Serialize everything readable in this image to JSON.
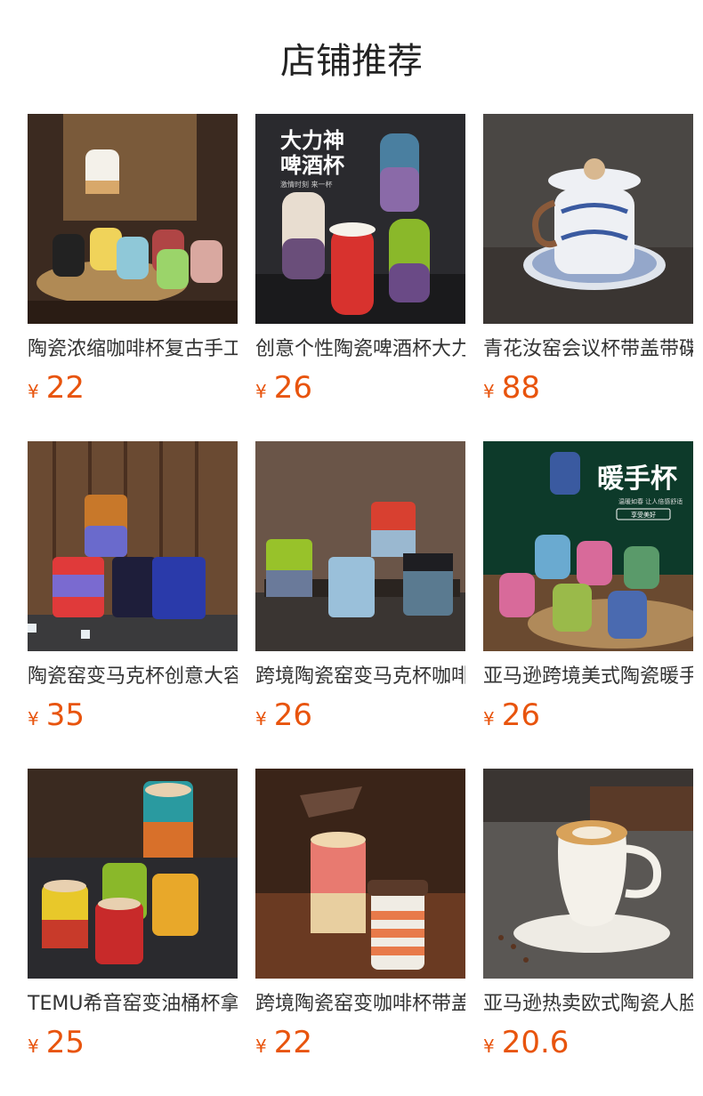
{
  "header": {
    "title": "店铺推荐"
  },
  "currency_symbol": "¥",
  "colors": {
    "price": "#e8540d"
  },
  "products": [
    {
      "name": "陶瓷浓缩咖啡杯复古手工窑变杯",
      "price": "22"
    },
    {
      "name": "创意个性陶瓷啤酒杯大力神杯",
      "price": "26",
      "image_text": [
        "大力神",
        "啤酒杯",
        "激情时刻 来一杯"
      ]
    },
    {
      "name": "青花汝窑会议杯带盖带碟套装",
      "price": "88"
    },
    {
      "name": "陶瓷窑变马克杯创意大容量",
      "price": "35"
    },
    {
      "name": "跨境陶瓷窑变马克杯咖啡杯",
      "price": "26"
    },
    {
      "name": "亚马逊跨境美式陶瓷暖手杯",
      "price": "26",
      "image_text": [
        "暖手杯",
        "温暖如春 让人倍感舒适",
        "享受美好"
      ]
    },
    {
      "name": "TEMU希音窑变油桶杯拿铁杯",
      "price": "25"
    },
    {
      "name": "跨境陶瓷窑变咖啡杯带盖",
      "price": "22"
    },
    {
      "name": "亚马逊热卖欧式陶瓷人脸杯",
      "price": "20.6"
    }
  ]
}
